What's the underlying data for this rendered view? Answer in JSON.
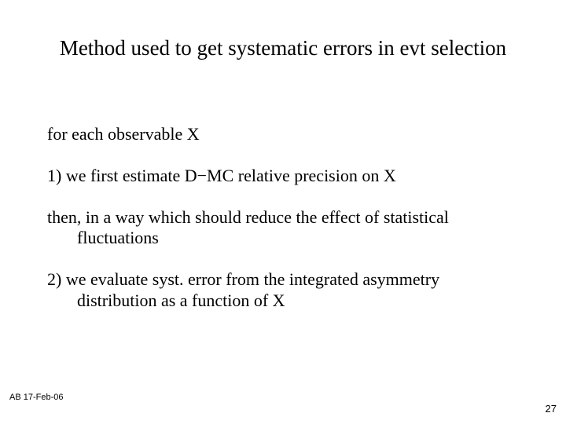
{
  "title": "Method used to get systematic errors in evt selection",
  "body": {
    "p1": "for each observable X",
    "p2": "1) we first estimate D−MC relative precision on X",
    "p3": "then, in a way which should reduce the effect of statistical fluctuations",
    "p4": "2) we evaluate syst. error from the integrated asymmetry distribution as a function of X"
  },
  "footer": {
    "left": "AB 17-Feb-06",
    "page": "27"
  }
}
